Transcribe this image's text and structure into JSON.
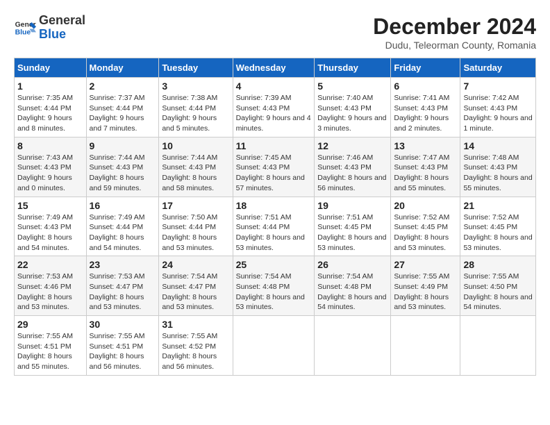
{
  "logo": {
    "line1": "General",
    "line2": "Blue"
  },
  "title": "December 2024",
  "subtitle": "Dudu, Teleorman County, Romania",
  "days_of_week": [
    "Sunday",
    "Monday",
    "Tuesday",
    "Wednesday",
    "Thursday",
    "Friday",
    "Saturday"
  ],
  "weeks": [
    [
      {
        "day": "1",
        "sunrise": "Sunrise: 7:35 AM",
        "sunset": "Sunset: 4:44 PM",
        "daylight": "Daylight: 9 hours and 8 minutes."
      },
      {
        "day": "2",
        "sunrise": "Sunrise: 7:37 AM",
        "sunset": "Sunset: 4:44 PM",
        "daylight": "Daylight: 9 hours and 7 minutes."
      },
      {
        "day": "3",
        "sunrise": "Sunrise: 7:38 AM",
        "sunset": "Sunset: 4:44 PM",
        "daylight": "Daylight: 9 hours and 5 minutes."
      },
      {
        "day": "4",
        "sunrise": "Sunrise: 7:39 AM",
        "sunset": "Sunset: 4:43 PM",
        "daylight": "Daylight: 9 hours and 4 minutes."
      },
      {
        "day": "5",
        "sunrise": "Sunrise: 7:40 AM",
        "sunset": "Sunset: 4:43 PM",
        "daylight": "Daylight: 9 hours and 3 minutes."
      },
      {
        "day": "6",
        "sunrise": "Sunrise: 7:41 AM",
        "sunset": "Sunset: 4:43 PM",
        "daylight": "Daylight: 9 hours and 2 minutes."
      },
      {
        "day": "7",
        "sunrise": "Sunrise: 7:42 AM",
        "sunset": "Sunset: 4:43 PM",
        "daylight": "Daylight: 9 hours and 1 minute."
      }
    ],
    [
      {
        "day": "8",
        "sunrise": "Sunrise: 7:43 AM",
        "sunset": "Sunset: 4:43 PM",
        "daylight": "Daylight: 9 hours and 0 minutes."
      },
      {
        "day": "9",
        "sunrise": "Sunrise: 7:44 AM",
        "sunset": "Sunset: 4:43 PM",
        "daylight": "Daylight: 8 hours and 59 minutes."
      },
      {
        "day": "10",
        "sunrise": "Sunrise: 7:44 AM",
        "sunset": "Sunset: 4:43 PM",
        "daylight": "Daylight: 8 hours and 58 minutes."
      },
      {
        "day": "11",
        "sunrise": "Sunrise: 7:45 AM",
        "sunset": "Sunset: 4:43 PM",
        "daylight": "Daylight: 8 hours and 57 minutes."
      },
      {
        "day": "12",
        "sunrise": "Sunrise: 7:46 AM",
        "sunset": "Sunset: 4:43 PM",
        "daylight": "Daylight: 8 hours and 56 minutes."
      },
      {
        "day": "13",
        "sunrise": "Sunrise: 7:47 AM",
        "sunset": "Sunset: 4:43 PM",
        "daylight": "Daylight: 8 hours and 55 minutes."
      },
      {
        "day": "14",
        "sunrise": "Sunrise: 7:48 AM",
        "sunset": "Sunset: 4:43 PM",
        "daylight": "Daylight: 8 hours and 55 minutes."
      }
    ],
    [
      {
        "day": "15",
        "sunrise": "Sunrise: 7:49 AM",
        "sunset": "Sunset: 4:43 PM",
        "daylight": "Daylight: 8 hours and 54 minutes."
      },
      {
        "day": "16",
        "sunrise": "Sunrise: 7:49 AM",
        "sunset": "Sunset: 4:44 PM",
        "daylight": "Daylight: 8 hours and 54 minutes."
      },
      {
        "day": "17",
        "sunrise": "Sunrise: 7:50 AM",
        "sunset": "Sunset: 4:44 PM",
        "daylight": "Daylight: 8 hours and 53 minutes."
      },
      {
        "day": "18",
        "sunrise": "Sunrise: 7:51 AM",
        "sunset": "Sunset: 4:44 PM",
        "daylight": "Daylight: 8 hours and 53 minutes."
      },
      {
        "day": "19",
        "sunrise": "Sunrise: 7:51 AM",
        "sunset": "Sunset: 4:45 PM",
        "daylight": "Daylight: 8 hours and 53 minutes."
      },
      {
        "day": "20",
        "sunrise": "Sunrise: 7:52 AM",
        "sunset": "Sunset: 4:45 PM",
        "daylight": "Daylight: 8 hours and 53 minutes."
      },
      {
        "day": "21",
        "sunrise": "Sunrise: 7:52 AM",
        "sunset": "Sunset: 4:45 PM",
        "daylight": "Daylight: 8 hours and 53 minutes."
      }
    ],
    [
      {
        "day": "22",
        "sunrise": "Sunrise: 7:53 AM",
        "sunset": "Sunset: 4:46 PM",
        "daylight": "Daylight: 8 hours and 53 minutes."
      },
      {
        "day": "23",
        "sunrise": "Sunrise: 7:53 AM",
        "sunset": "Sunset: 4:47 PM",
        "daylight": "Daylight: 8 hours and 53 minutes."
      },
      {
        "day": "24",
        "sunrise": "Sunrise: 7:54 AM",
        "sunset": "Sunset: 4:47 PM",
        "daylight": "Daylight: 8 hours and 53 minutes."
      },
      {
        "day": "25",
        "sunrise": "Sunrise: 7:54 AM",
        "sunset": "Sunset: 4:48 PM",
        "daylight": "Daylight: 8 hours and 53 minutes."
      },
      {
        "day": "26",
        "sunrise": "Sunrise: 7:54 AM",
        "sunset": "Sunset: 4:48 PM",
        "daylight": "Daylight: 8 hours and 54 minutes."
      },
      {
        "day": "27",
        "sunrise": "Sunrise: 7:55 AM",
        "sunset": "Sunset: 4:49 PM",
        "daylight": "Daylight: 8 hours and 53 minutes."
      },
      {
        "day": "28",
        "sunrise": "Sunrise: 7:55 AM",
        "sunset": "Sunset: 4:50 PM",
        "daylight": "Daylight: 8 hours and 54 minutes."
      }
    ],
    [
      {
        "day": "29",
        "sunrise": "Sunrise: 7:55 AM",
        "sunset": "Sunset: 4:51 PM",
        "daylight": "Daylight: 8 hours and 55 minutes."
      },
      {
        "day": "30",
        "sunrise": "Sunrise: 7:55 AM",
        "sunset": "Sunset: 4:51 PM",
        "daylight": "Daylight: 8 hours and 56 minutes."
      },
      {
        "day": "31",
        "sunrise": "Sunrise: 7:55 AM",
        "sunset": "Sunset: 4:52 PM",
        "daylight": "Daylight: 8 hours and 56 minutes."
      },
      null,
      null,
      null,
      null
    ]
  ]
}
